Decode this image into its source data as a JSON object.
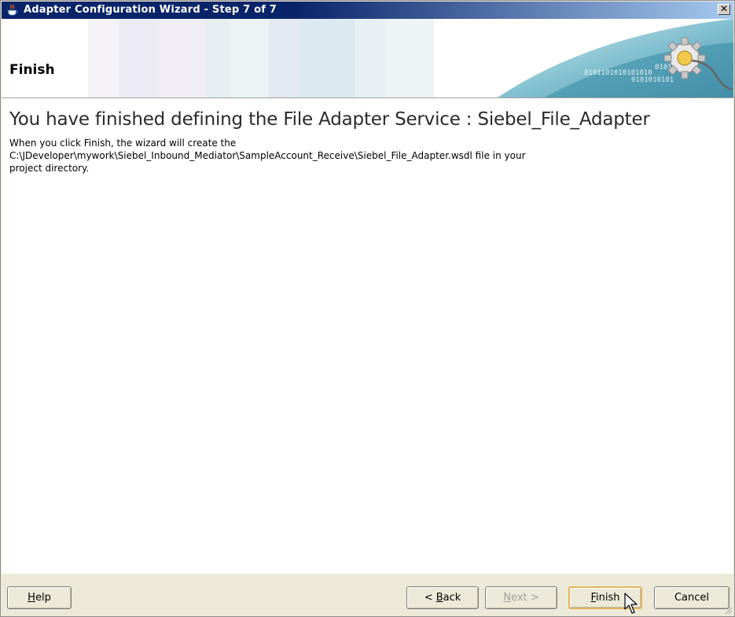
{
  "window": {
    "title": "Adapter Configuration Wizard - Step 7 of 7",
    "close_glyph": "✕"
  },
  "banner": {
    "title": "Finish",
    "binary_text_1": "0101101010101010",
    "binary_text_2": "0101",
    "binary_text_3": "0101010101"
  },
  "content": {
    "heading": "You have finished defining the File Adapter Service : Siebel_File_Adapter",
    "desc_line1": "When you click Finish, the wizard will create the",
    "desc_line2": "C:\\JDeveloper\\mywork\\Siebel_Inbound_Mediator\\SampleAccount_Receive\\Siebel_File_Adapter.wsdl file in your",
    "desc_line3": "project directory."
  },
  "buttons": {
    "help": {
      "prefix": "",
      "mnemonic": "H",
      "suffix": "elp"
    },
    "back": {
      "prefix": "< ",
      "mnemonic": "B",
      "suffix": "ack"
    },
    "next": {
      "prefix": "",
      "mnemonic": "N",
      "suffix": "ext >"
    },
    "finish": {
      "prefix": "",
      "mnemonic": "F",
      "suffix": "inish"
    },
    "cancel": {
      "label": "Cancel"
    }
  },
  "state": {
    "next_enabled": false,
    "default_button": "finish"
  },
  "colors": {
    "titlebar": "#0a246a",
    "dialog_bg": "#ece9d8",
    "default_button_border": "#e3b35a"
  },
  "icons": [
    "java-cup-icon",
    "close-icon",
    "gear-plug-icon",
    "mouse-cursor-icon"
  ]
}
